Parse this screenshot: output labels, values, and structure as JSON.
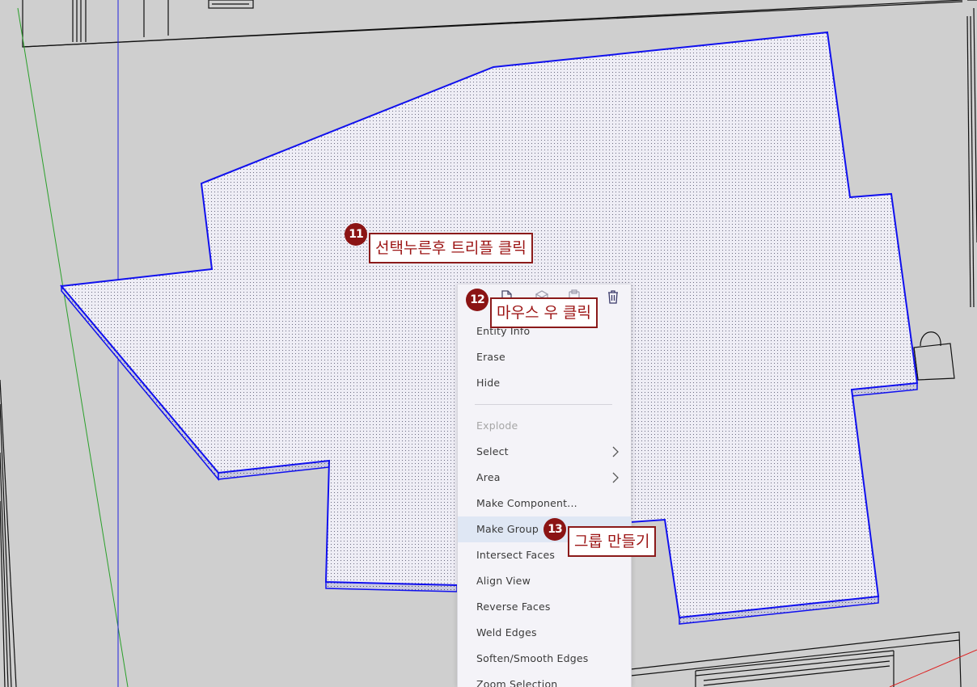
{
  "colors": {
    "background": "#cfcfcf",
    "face_fill": "#eeedf5",
    "selection_edge": "#1010ee",
    "callout_border": "#8b1a1a",
    "callout_text": "#9c1414",
    "badge_fill": "#8b1414",
    "menu_bg": "#f4f3f8",
    "menu_highlight": "#dfe7f4",
    "axis_green": "#2aa02a",
    "axis_blue": "#2222dd",
    "axis_red": "#dd2222"
  },
  "toolbar": {
    "icons": [
      "copy-icon",
      "component-icon",
      "paste-icon",
      "delete-icon"
    ]
  },
  "context_menu": {
    "items": [
      {
        "label": "Entity Info",
        "icon": ""
      },
      {
        "label": "Erase",
        "icon": ""
      },
      {
        "label": "Hide",
        "icon": ""
      },
      {
        "label": "Explode",
        "icon": "",
        "disabled": true
      },
      {
        "label": "Select",
        "icon": "chevron-right-icon"
      },
      {
        "label": "Area",
        "icon": "chevron-right-icon"
      },
      {
        "label": "Make Component...",
        "icon": ""
      },
      {
        "label": "Make Group",
        "icon": "",
        "highlighted": true
      },
      {
        "label": "Intersect Faces",
        "icon": ""
      },
      {
        "label": "Align View",
        "icon": ""
      },
      {
        "label": "Reverse Faces",
        "icon": ""
      },
      {
        "label": "Weld Edges",
        "icon": ""
      },
      {
        "label": "Soften/Smooth Edges",
        "icon": ""
      },
      {
        "label": "Zoom Selection",
        "icon": ""
      }
    ]
  },
  "annotations": [
    {
      "number": "11",
      "text": "선택누른후 트리플 클릭"
    },
    {
      "number": "12",
      "text": "마우스 우 클릭"
    },
    {
      "number": "13",
      "text": "그룹 만들기"
    }
  ]
}
